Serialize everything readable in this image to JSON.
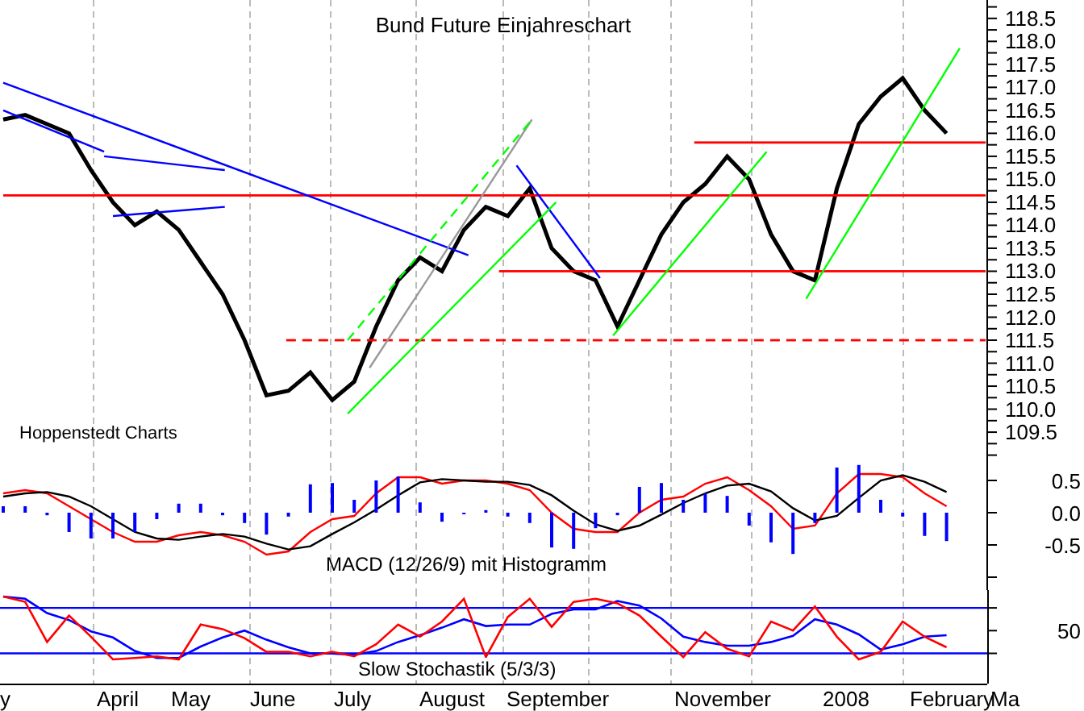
{
  "chart": {
    "chart_data": {
      "type": "line",
      "title": "Bund Future Einjahreschart",
      "categories": [
        null,
        null,
        null,
        null,
        null,
        null,
        null,
        null,
        null,
        null,
        null,
        null,
        null,
        null,
        null,
        null,
        null,
        null,
        null,
        null,
        null,
        null,
        null,
        null,
        null,
        null,
        null,
        null,
        null,
        null,
        null,
        null,
        null,
        null,
        null,
        null,
        null,
        null,
        null,
        null,
        null,
        null,
        null,
        null
      ],
      "series": [
        {
          "color": "#000000",
          "values": [
            116.3,
            116.4,
            116.2,
            116.0,
            115.2,
            114.5,
            114.0,
            114.3,
            113.9,
            113.2,
            112.5,
            111.5,
            110.3,
            110.4,
            110.8,
            110.2,
            110.6,
            111.8,
            112.8,
            113.3,
            113.0,
            113.9,
            114.4,
            114.2,
            114.8,
            113.5,
            113.0,
            112.8,
            111.8,
            112.8,
            113.8,
            114.5,
            114.9,
            115.5,
            115.0,
            113.8,
            113.0,
            112.8,
            114.8,
            116.2,
            116.8,
            117.2,
            116.5,
            116.0
          ]
        }
      ],
      "ylim": [
        108.8,
        118.9
      ],
      "grid": true,
      "yticks": [
        {
          "value": 109.5,
          "label": "109.5"
        },
        {
          "value": 110,
          "label": "110.0"
        },
        {
          "value": 110.5,
          "label": "110.5"
        },
        {
          "value": 111,
          "label": "111.0"
        },
        {
          "value": 111.5,
          "label": "111.5"
        },
        {
          "value": 112,
          "label": "112.0"
        },
        {
          "value": 112.5,
          "label": "112.5"
        },
        {
          "value": 113,
          "label": "113.0"
        },
        {
          "value": 113.5,
          "label": "113.5"
        },
        {
          "value": 114,
          "label": "114.0"
        },
        {
          "value": 114.5,
          "label": "114.5"
        },
        {
          "value": 115,
          "label": "115.0"
        },
        {
          "value": 115.5,
          "label": "115.5"
        },
        {
          "value": 116,
          "label": "116.0"
        },
        {
          "value": 116.5,
          "label": "116.5"
        },
        {
          "value": 117,
          "label": "117.0"
        },
        {
          "value": 117.5,
          "label": "117.5"
        },
        {
          "value": 118,
          "label": "118.0"
        },
        {
          "value": 118.5,
          "label": "118.5"
        }
      ]
    },
    "overlays": [
      {
        "kind": "horizontal",
        "color": "#ff0000",
        "dashed": false
      },
      {
        "kind": "horizontal",
        "color": "#ff0000",
        "dashed": false
      },
      {
        "kind": "horizontal",
        "color": "#ff0000",
        "dashed": false
      },
      {
        "kind": "horizontal",
        "color": "#ff0000",
        "dashed": true
      },
      {
        "kind": "trend",
        "color": "#0000ff",
        "dashed": false
      },
      {
        "kind": "trend",
        "color": "#0000ff",
        "dashed": false
      },
      {
        "kind": "trend",
        "color": "#0000ff",
        "dashed": false
      },
      {
        "kind": "trend",
        "color": "#0000ff",
        "dashed": false
      },
      {
        "kind": "trend",
        "color": "#0000ff",
        "dashed": false
      },
      {
        "kind": "trend",
        "color": "#999999",
        "dashed": false
      },
      {
        "kind": "trend",
        "color": "#00ff00",
        "dashed": true
      },
      {
        "kind": "trend",
        "color": "#00ff00",
        "dashed": false
      },
      {
        "kind": "trend",
        "color": "#00ff00",
        "dashed": false
      },
      {
        "kind": "trend",
        "color": "#00ff00",
        "dashed": false
      }
    ],
    "credit": "Hoppenstedt Charts"
  },
  "macd": {
    "chart_data": {
      "type": "line",
      "title": "MACD (12/26/9) mit Histogramm",
      "categories": [
        null,
        null,
        null,
        null,
        null,
        null,
        null,
        null,
        null,
        null,
        null,
        null,
        null,
        null,
        null,
        null,
        null,
        null,
        null,
        null,
        null,
        null,
        null,
        null,
        null,
        null,
        null,
        null,
        null,
        null,
        null,
        null,
        null,
        null,
        null,
        null,
        null,
        null,
        null,
        null,
        null,
        null,
        null,
        null
      ],
      "series": [
        {
          "color": "#ff0000",
          "values": [
            0.3,
            0.35,
            0.3,
            0.1,
            -0.1,
            -0.3,
            -0.45,
            -0.45,
            -0.35,
            -0.3,
            -0.35,
            -0.45,
            -0.65,
            -0.6,
            -0.3,
            -0.1,
            -0.05,
            0.3,
            0.55,
            0.55,
            0.45,
            0.5,
            0.5,
            0.45,
            0.35,
            0.0,
            -0.25,
            -0.3,
            -0.3,
            0.0,
            0.2,
            0.25,
            0.45,
            0.55,
            0.35,
            0.1,
            -0.25,
            -0.2,
            0.3,
            0.6,
            0.6,
            0.55,
            0.3,
            0.1
          ]
        },
        {
          "color": "#000000",
          "values": [
            0.25,
            0.3,
            0.32,
            0.25,
            0.1,
            -0.1,
            -0.3,
            -0.4,
            -0.42,
            -0.37,
            -0.33,
            -0.37,
            -0.48,
            -0.57,
            -0.52,
            -0.33,
            -0.15,
            0.05,
            0.27,
            0.47,
            0.52,
            0.5,
            0.48,
            0.48,
            0.43,
            0.27,
            0.03,
            -0.18,
            -0.28,
            -0.2,
            -0.03,
            0.15,
            0.3,
            0.42,
            0.45,
            0.33,
            0.07,
            -0.12,
            -0.05,
            0.23,
            0.5,
            0.58,
            0.48,
            0.32
          ]
        },
        {
          "color": "#0000ff",
          "type": "bar",
          "values": [
            0.1,
            0.1,
            -0.04,
            -0.3,
            -0.4,
            -0.4,
            -0.3,
            -0.1,
            0.14,
            0.14,
            -0.04,
            -0.16,
            -0.34,
            -0.06,
            0.44,
            0.46,
            0.2,
            0.5,
            0.56,
            0.16,
            -0.14,
            0.0,
            0.04,
            -0.06,
            -0.16,
            -0.54,
            -0.56,
            -0.24,
            -0.04,
            0.4,
            0.46,
            0.2,
            0.3,
            0.26,
            -0.2,
            -0.46,
            -0.64,
            -0.16,
            0.7,
            0.74,
            0.2,
            -0.06,
            -0.36,
            -0.44
          ]
        }
      ],
      "ylim": [
        -1.2,
        0.75
      ],
      "grid": true,
      "yticks": [
        {
          "value": 0.5,
          "label": "0.5"
        },
        {
          "value": 0,
          "label": "0.0"
        },
        {
          "value": -0.5,
          "label": "-0.5"
        }
      ]
    }
  },
  "stochastic": {
    "title": "Slow Stochastik (5/3/3)",
    "scale_label": "50"
  },
  "time_axis": {
    "labels": [
      "y",
      "April",
      "May",
      "June",
      "July",
      "August",
      "September",
      "November",
      "2008",
      "February",
      "Ma"
    ]
  }
}
